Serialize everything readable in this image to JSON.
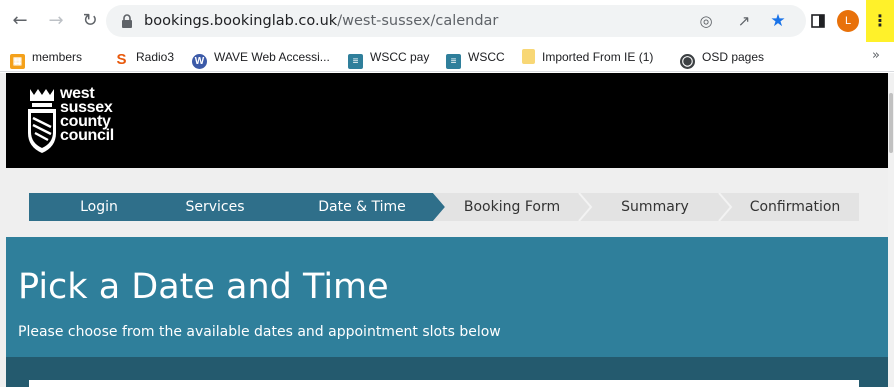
{
  "browser": {
    "url_host": "bookings.bookinglab.co.uk",
    "url_path": "/west-sussex/calendar",
    "profile_initial": "L"
  },
  "bookmarks": [
    {
      "label": "members",
      "icon": "grid-app-icon",
      "color": "#f4a11b"
    },
    {
      "label": "Radio3",
      "icon": "s-logo-icon",
      "color": "#e8590c"
    },
    {
      "label": "WAVE Web Accessi...",
      "icon": "wave-icon",
      "color": "#3c5aa8"
    },
    {
      "label": "WSCC pay",
      "icon": "wscc-icon",
      "color": "#2f7f9b"
    },
    {
      "label": "WSCC",
      "icon": "wscc-icon",
      "color": "#2f7f9b"
    },
    {
      "label": "Imported From IE (1)",
      "icon": "folder-icon",
      "color": "#f8d775"
    },
    {
      "label": "OSD pages",
      "icon": "globe-icon",
      "color": "#3c4043"
    }
  ],
  "bookmarks_more": "»",
  "logo": {
    "lines": [
      "west",
      "sussex",
      "county",
      "council"
    ]
  },
  "steps": [
    {
      "label": "Login",
      "state": "active"
    },
    {
      "label": "Services",
      "state": "active"
    },
    {
      "label": "Date & Time",
      "state": "active"
    },
    {
      "label": "Booking Form",
      "state": "inactive"
    },
    {
      "label": "Summary",
      "state": "inactive"
    },
    {
      "label": "Confirmation",
      "state": "inactive"
    }
  ],
  "hero": {
    "title": "Pick a Date and Time",
    "subtitle": "Please choose from the available dates and appointment slots below"
  },
  "colors": {
    "step_active": "#2f6f8a",
    "step_inactive": "#e3e3e3",
    "hero": "#2f7f9b",
    "header": "#000000"
  }
}
